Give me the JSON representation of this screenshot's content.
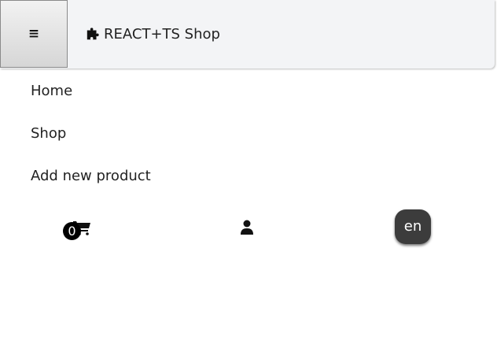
{
  "header": {
    "menu_icon_glyph": "≡",
    "brand_icon": "puzzle-icon",
    "brand_title": "REACT+TS Shop"
  },
  "nav": {
    "items": [
      {
        "label": "Home"
      },
      {
        "label": "Shop"
      },
      {
        "label": "Add new product"
      }
    ]
  },
  "toolbar": {
    "cart_count": "0",
    "cart_icon": "cart-icon",
    "user_icon": "user-icon",
    "language": "en"
  },
  "colors": {
    "header_bg": "#f3f4f6",
    "lang_button_bg": "#3c3c3c",
    "badge_bg": "#000000"
  }
}
